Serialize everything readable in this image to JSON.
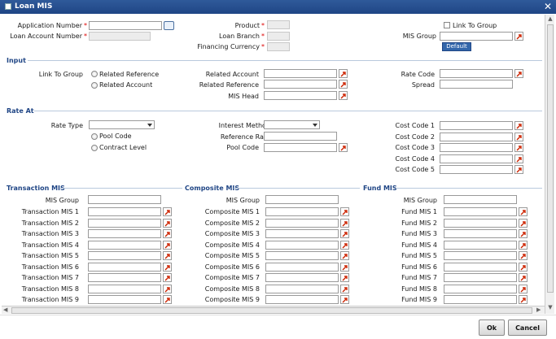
{
  "window": {
    "title": "Loan MIS"
  },
  "header": {
    "application_number": {
      "label": "Application Number",
      "value": ""
    },
    "loan_account_number": {
      "label": "Loan Account Number",
      "value": ""
    },
    "product": {
      "label": "Product",
      "value": ""
    },
    "loan_branch": {
      "label": "Loan Branch",
      "value": ""
    },
    "financing_currency": {
      "label": "Financing Currency",
      "value": ""
    },
    "link_to_group_label": "Link To Group",
    "mis_group_label": "MIS Group",
    "default_label": "Default"
  },
  "input": {
    "title": "Input",
    "link_to_group_label": "Link To Group",
    "related_reference_radio": "Related Reference",
    "related_account_radio": "Related Account",
    "related_account_label": "Related Account",
    "related_reference_label": "Related Reference",
    "mis_head_label": "MIS Head",
    "rate_code_label": "Rate Code",
    "spread_label": "Spread"
  },
  "rate_at": {
    "title": "Rate At",
    "rate_type_label": "Rate Type",
    "rate_type_value": "",
    "pool_code_radio": "Pool Code",
    "contract_level_radio": "Contract Level",
    "interest_method_label": "Interest Method",
    "interest_method_value": "",
    "reference_rate_label": "Reference Rate",
    "pool_code_label": "Pool Code",
    "cost_codes": [
      "Cost Code 1",
      "Cost Code 2",
      "Cost Code 3",
      "Cost Code 4",
      "Cost Code 5"
    ]
  },
  "transaction_mis": {
    "title": "Transaction MIS",
    "group_label": "MIS Group",
    "fields": [
      "Transaction MIS 1",
      "Transaction MIS 2",
      "Transaction MIS 3",
      "Transaction MIS 4",
      "Transaction MIS 5",
      "Transaction MIS 6",
      "Transaction MIS 7",
      "Transaction MIS 8",
      "Transaction MIS 9"
    ]
  },
  "composite_mis": {
    "title": "Composite MIS",
    "group_label": "MIS Group",
    "fields": [
      "Composite MIS 1",
      "Composite MIS 2",
      "Composite MIS 3",
      "Composite MIS 4",
      "Composite MIS 5",
      "Composite MIS 6",
      "Composite MIS 7",
      "Composite MIS 8",
      "Composite MIS 9"
    ]
  },
  "fund_mis": {
    "title": "Fund MIS",
    "group_label": "MIS Group",
    "fields": [
      "Fund MIS 1",
      "Fund MIS 2",
      "Fund MIS 3",
      "Fund MIS 4",
      "Fund MIS 5",
      "Fund MIS 6",
      "Fund MIS 7",
      "Fund MIS 8",
      "Fund MIS 9"
    ]
  },
  "footer": {
    "ok_label": "Ok",
    "cancel_label": "Cancel"
  },
  "colors": {
    "titlebar": "#1f4585",
    "section": "#1f4585",
    "required": "#dd0000",
    "lov_icon": "#cc2200"
  }
}
